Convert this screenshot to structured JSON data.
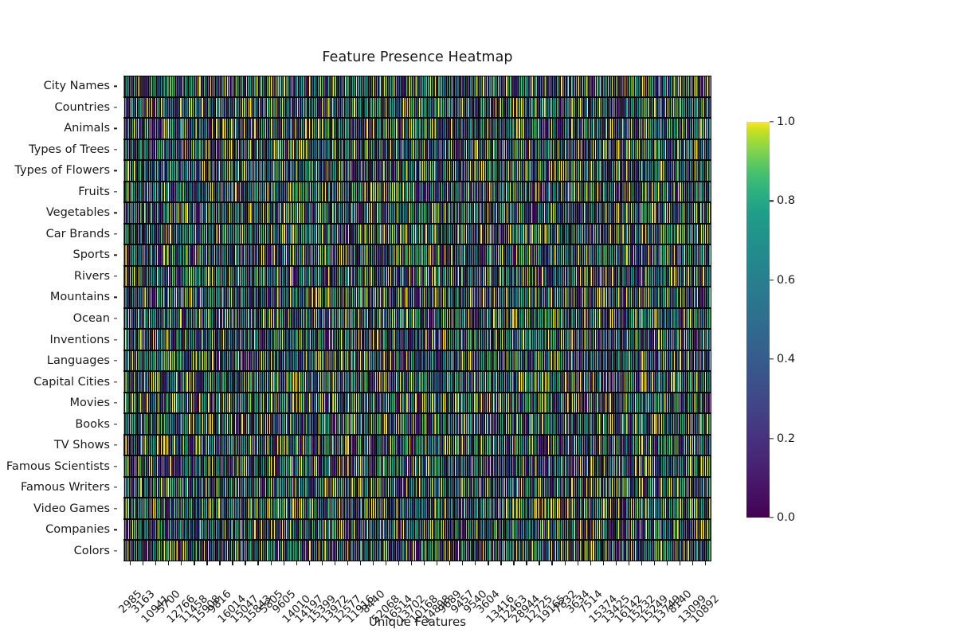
{
  "chart_data": {
    "type": "heatmap",
    "title": "Feature Presence Heatmap",
    "xlabel": "Unique Features",
    "ylabel": "",
    "colormap": "viridis",
    "colorbar": {
      "vmin": 0.0,
      "vmax": 1.0,
      "ticks": [
        0.0,
        0.2,
        0.4,
        0.6,
        0.8,
        1.0
      ],
      "tick_labels": [
        "0.0",
        "0.2",
        "0.4",
        "0.6",
        "0.8",
        "1.0"
      ],
      "position": "right"
    },
    "grid": false,
    "categories_y": [
      "City Names",
      "Countries",
      "Animals",
      "Types of Trees",
      "Types of Flowers",
      "Fruits",
      "Vegetables",
      "Car Brands",
      "Sports",
      "Rivers",
      "Mountains",
      "Ocean",
      "Inventions",
      "Languages",
      "Capital Cities",
      "Movies",
      "Books",
      "TV Shows",
      "Famous Scientists",
      "Famous Writers",
      "Video Games",
      "Companies",
      "Colors"
    ],
    "xtick_labels": [
      "2985",
      "3163",
      "10941",
      "5700",
      "12766",
      "11458",
      "15908",
      "9816",
      "16014",
      "15047",
      "15843",
      "5805",
      "9605",
      "14010",
      "14197",
      "15399",
      "13972",
      "12577",
      "11916",
      "8440",
      "52068",
      "16514",
      "13702",
      "10168",
      "14898",
      "9689",
      "9457",
      "9540",
      "3604",
      "13416",
      "12463",
      "28944",
      "12725",
      "19165",
      "7832",
      "3634",
      "7514",
      "15374",
      "13425",
      "16142",
      "15232",
      "15249",
      "13749",
      "8140",
      "13099",
      "10892"
    ],
    "n_rows": 23,
    "n_cols": 460,
    "value_range": [
      0.0,
      1.0
    ],
    "description": "Dense binary/continuous feature presence matrix rendered as narrow vertical stripes; 23 category rows by many unique-feature columns, values spanning 0.0 to 1.0 on the viridis colormap."
  }
}
